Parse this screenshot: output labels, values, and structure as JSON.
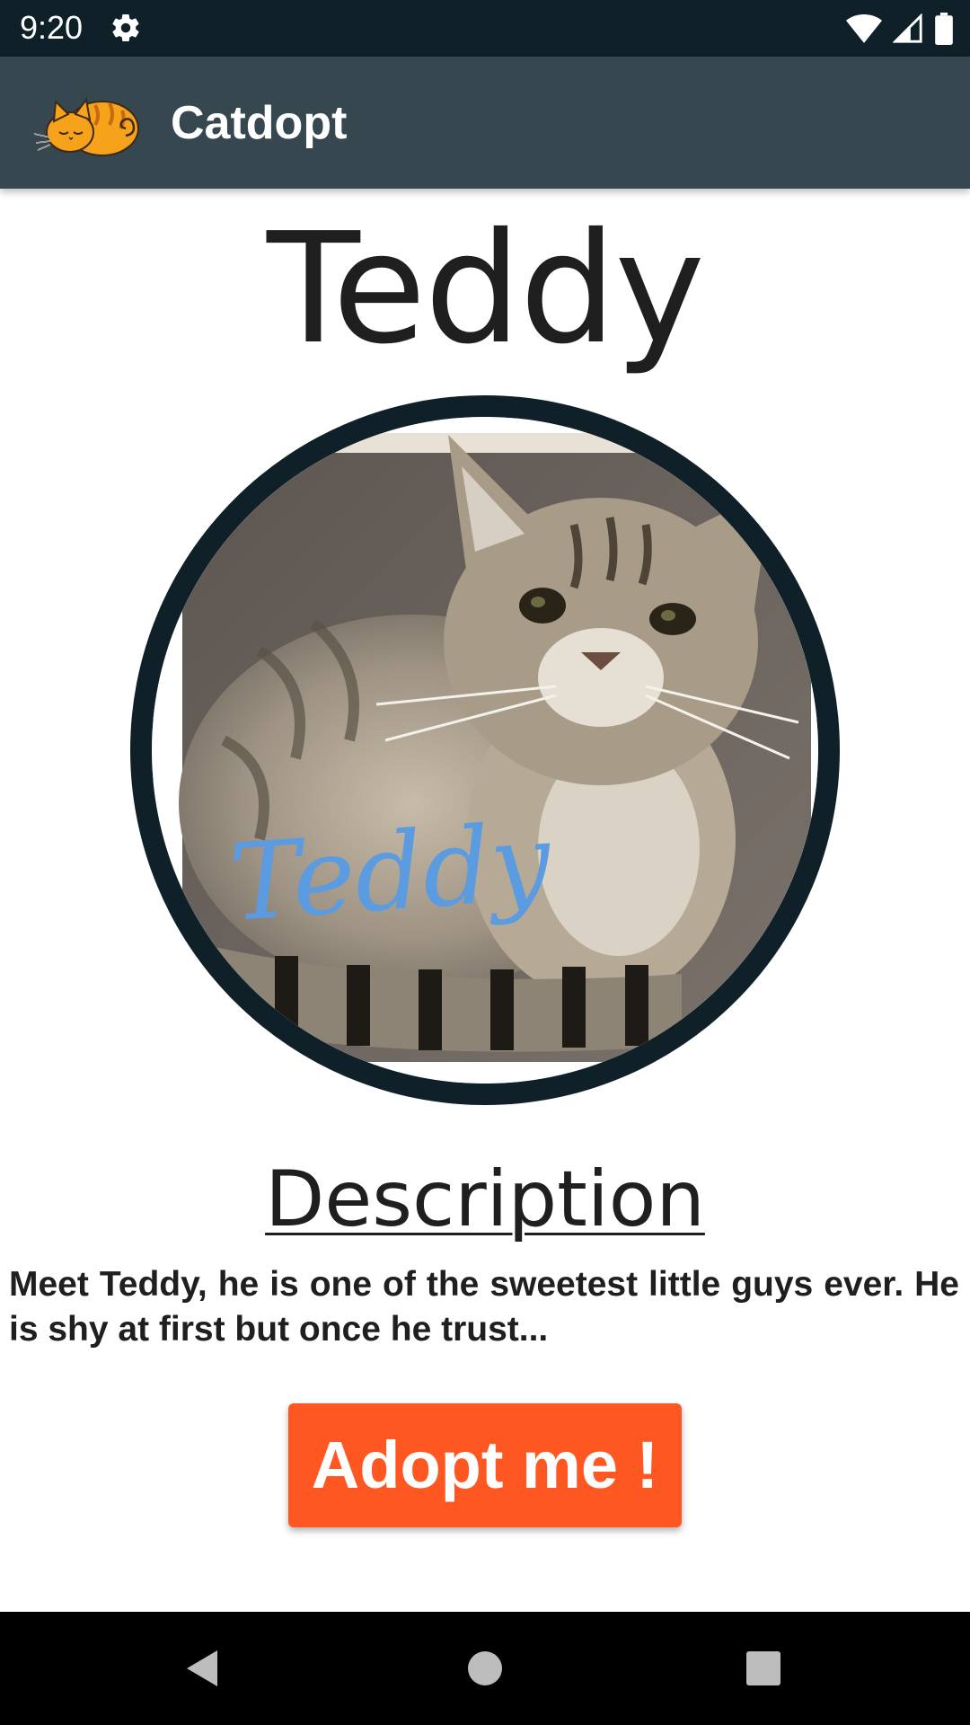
{
  "status_bar": {
    "time": "9:20",
    "icons": [
      "gear-icon",
      "wifi-icon",
      "signal-icon",
      "battery-icon"
    ]
  },
  "app_bar": {
    "title": "Catdopt",
    "logo_icon": "sleeping-cat-logo"
  },
  "cat": {
    "name": "Teddy",
    "photo_caption": "Teddy"
  },
  "description": {
    "heading": "Description",
    "text": "Meet Teddy, he is one of the sweetest little guys ever. He is shy at first but once he trust..."
  },
  "actions": {
    "adopt_label": "Adopt me !"
  },
  "nav_bar": {
    "icons": [
      "back-icon",
      "home-icon",
      "recents-icon"
    ]
  },
  "colors": {
    "status_bar": "#0f2028",
    "app_bar": "#37474f",
    "accent": "#ff5722",
    "caption": "#5b9bdf"
  }
}
